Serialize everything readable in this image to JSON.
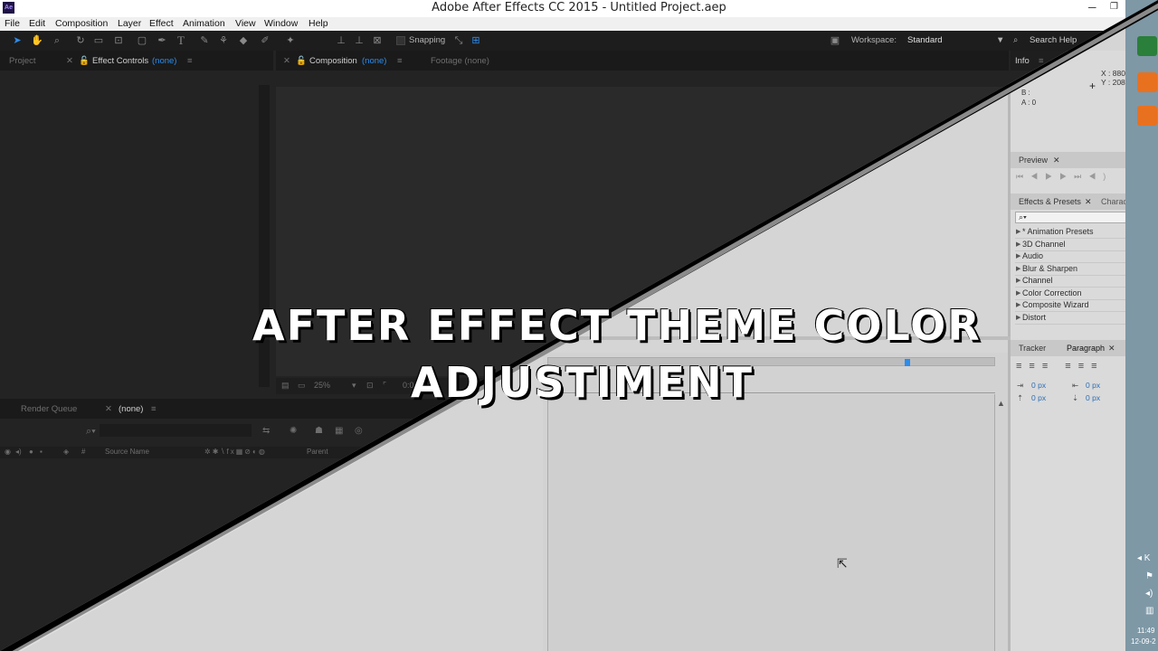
{
  "window": {
    "title": "Adobe After Effects CC 2015 - Untitled Project.aep",
    "logo": "Ae"
  },
  "menu": [
    "File",
    "Edit",
    "Composition",
    "Layer",
    "Effect",
    "Animation",
    "View",
    "Window",
    "Help"
  ],
  "toolbar": {
    "snapping_label": "Snapping",
    "workspace_label": "Workspace:",
    "workspace_value": "Standard",
    "search_placeholder": "Search Help"
  },
  "project_panel": {
    "project_tab": "Project",
    "effect_controls_tab": "Effect Controls",
    "effect_controls_value": "(none)"
  },
  "composition_panel": {
    "tab": "Composition",
    "tab_value": "(none)",
    "footage_tab": "Footage (none)",
    "zoom": "25%",
    "time": "0:0"
  },
  "info_panel": {
    "tab": "Info",
    "x_readout": "X : 880",
    "y_readout": "Y : 208",
    "b_label": "B :",
    "a_label": "A : 0"
  },
  "preview_panel": {
    "tab": "Preview"
  },
  "effects_panel": {
    "tab": "Effects & Presets",
    "character_tab": "Characte",
    "search_placeholder": "⌕▾",
    "items": [
      "* Animation Presets",
      "3D Channel",
      "Audio",
      "Blur & Sharpen",
      "Channel",
      "Color Correction",
      "Composite Wizard",
      "Distort"
    ]
  },
  "tracker_panel": {
    "tracker_tab": "Tracker",
    "paragraph_tab": "Paragraph",
    "indent_1": "0 px",
    "indent_2": "0 px",
    "indent_3": "0 px",
    "indent_4": "0 px"
  },
  "timeline_panel": {
    "render_queue_tab": "Render Queue",
    "comp_tab": "(none)",
    "source_name_col": "Source Name",
    "parent_col": "Parent",
    "hash_col": "#"
  },
  "overlay": {
    "line1": "AFTER EFFECT THEME COLOR",
    "line2": "ADJUSTIMENT"
  },
  "colors": {
    "accent": "#2d8ceb",
    "dark_bg": "#232323",
    "light_bg": "#dcdcdc"
  },
  "taskbar": {
    "time": "11:49",
    "date": "12-09-2"
  }
}
